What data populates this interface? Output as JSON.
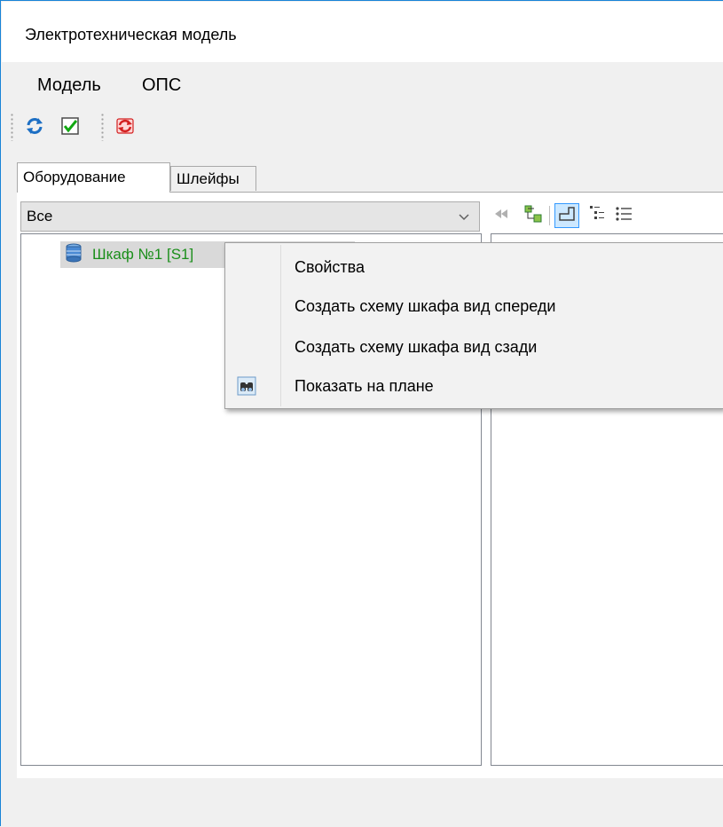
{
  "window": {
    "title": "Электротехническая модель"
  },
  "menu": {
    "items": [
      "Модель",
      "ОПС"
    ]
  },
  "toolbar": {
    "buttons": [
      "refresh-icon",
      "check-icon",
      "sync-red-icon"
    ]
  },
  "tabs": [
    {
      "label": "Оборудование",
      "active": true
    },
    {
      "label": "Шлейфы",
      "active": false
    }
  ],
  "filter": {
    "selected": "Все"
  },
  "tree": {
    "nodes": [
      {
        "label": "Шкаф №1 [S1]",
        "color": "#1a8e1a"
      }
    ]
  },
  "context_menu": {
    "items": [
      {
        "label": "Свойства",
        "icon": ""
      },
      {
        "label": "Создать схему шкафа вид спереди",
        "icon": ""
      },
      {
        "label": "Создать схему шкафа вид сзади",
        "icon": ""
      },
      {
        "label": "Показать на плане",
        "icon": "binoculars-icon"
      }
    ]
  },
  "colors": {
    "accent": "#1883d7",
    "tree_text": "#1a8e1a",
    "selection": "#cce8ff"
  }
}
